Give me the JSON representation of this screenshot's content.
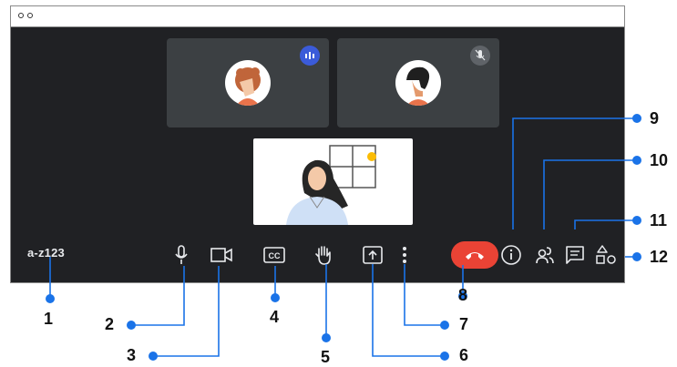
{
  "meeting": {
    "code": "a-z123"
  },
  "callouts": [
    "1",
    "2",
    "3",
    "4",
    "5",
    "6",
    "7",
    "8",
    "9",
    "10",
    "11",
    "12"
  ],
  "colors": {
    "background": "#202124",
    "tile": "#3c4043",
    "hangup": "#ea4335",
    "callout_line": "#1a73e8",
    "speaking_badge": "#3b5bd9"
  },
  "controls": {
    "left": [
      "microphone-icon",
      "camera-icon",
      "captions-icon",
      "raise-hand-icon",
      "present-icon",
      "more-options-icon",
      "end-call-button"
    ],
    "right": [
      "meeting-info-icon",
      "people-icon",
      "chat-icon",
      "activities-icon"
    ]
  }
}
